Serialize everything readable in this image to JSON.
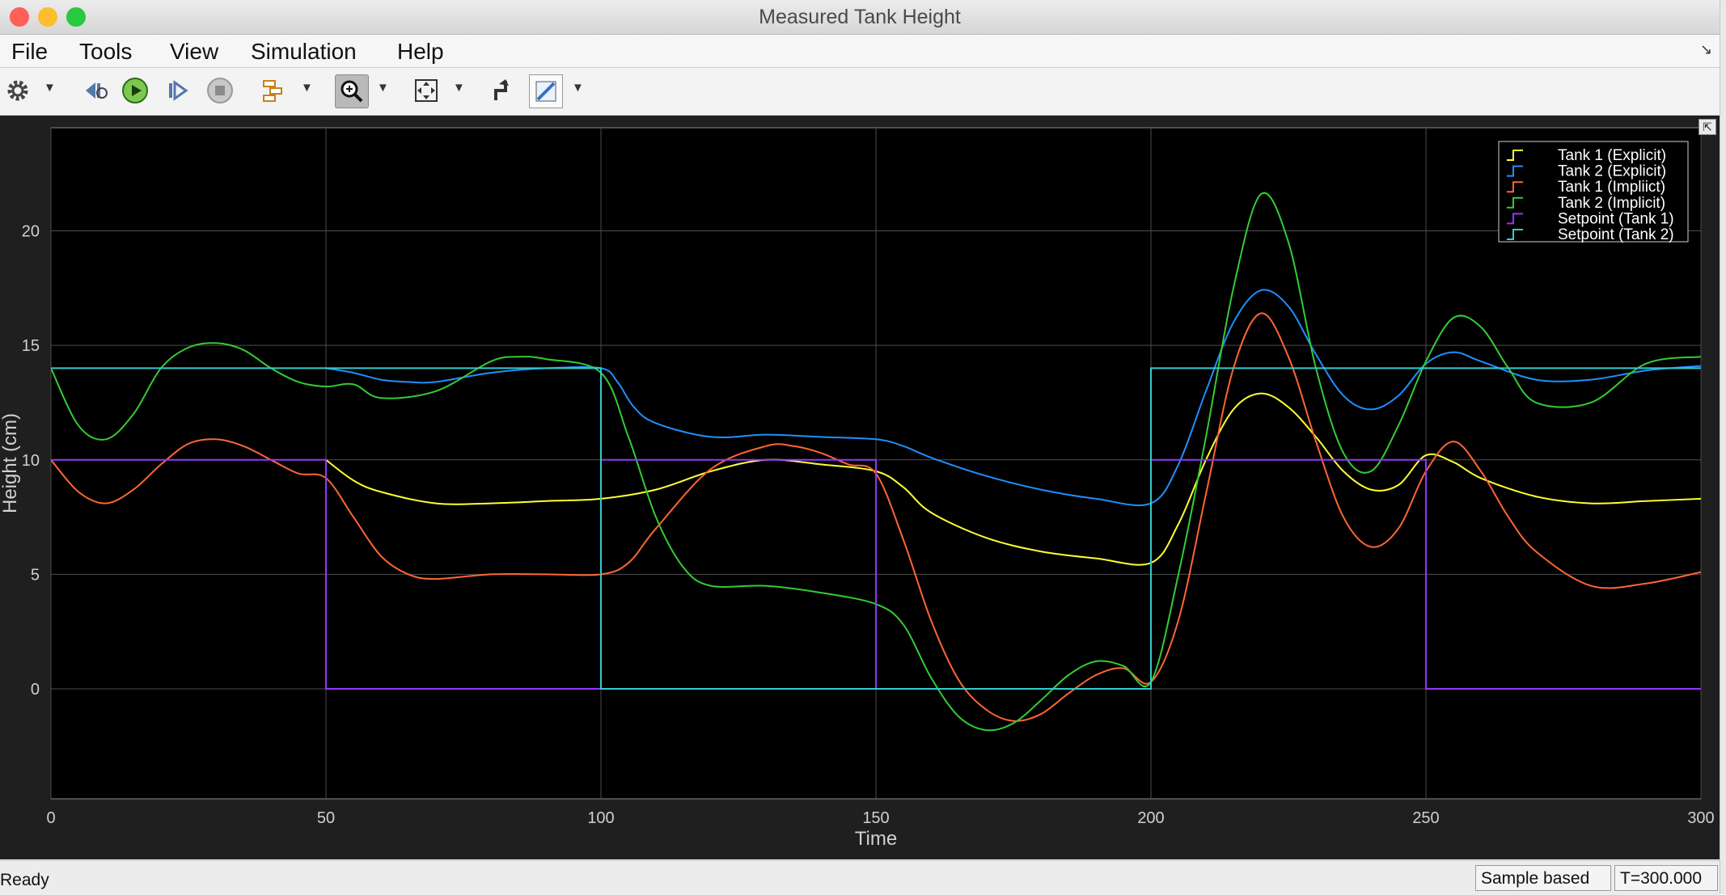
{
  "window": {
    "title": "Measured Tank Height"
  },
  "menu": {
    "file": "File",
    "tools": "Tools",
    "view": "View",
    "simulation": "Simulation",
    "help": "Help"
  },
  "status": {
    "text": "Ready",
    "mode": "Sample based",
    "time": "T=300.000"
  },
  "icons": [
    "gear-icon",
    "step-back-icon",
    "run-icon",
    "step-forward-icon",
    "stop-icon",
    "signal-selector-icon",
    "zoom-in-icon",
    "fit-to-view-icon",
    "triggers-icon",
    "measurements-icon"
  ],
  "chart_data": {
    "type": "line",
    "xlabel": "Time",
    "ylabel": "Height (cm)",
    "xlim": [
      0,
      300
    ],
    "ylim": [
      -4.8,
      24.5
    ],
    "xticks": [
      0,
      50,
      100,
      150,
      200,
      250,
      300
    ],
    "yticks": [
      0,
      5,
      10,
      15,
      20
    ],
    "grid": true,
    "legend_position": "top-right",
    "background": "#000000",
    "series": [
      {
        "name": "Tank 1 (Explicit)",
        "color": "#ffff33",
        "x": [
          50,
          55,
          60,
          70,
          80,
          90,
          100,
          110,
          120,
          130,
          140,
          150,
          155,
          160,
          170,
          180,
          190,
          200,
          205,
          210,
          215,
          220,
          225,
          230,
          235,
          240,
          245,
          250,
          255,
          260,
          270,
          280,
          290,
          300
        ],
        "y": [
          10,
          9.1,
          8.6,
          8.1,
          8.1,
          8.2,
          8.3,
          8.7,
          9.5,
          10,
          9.8,
          9.5,
          8.8,
          7.7,
          6.6,
          6,
          5.7,
          5.5,
          7.2,
          10,
          12.2,
          12.9,
          12.3,
          11,
          9.5,
          8.7,
          8.9,
          10.2,
          9.9,
          9.2,
          8.4,
          8.1,
          8.2,
          8.3
        ]
      },
      {
        "name": "Tank 2 (Explicit)",
        "color": "#1f8fff",
        "x": [
          50,
          55,
          60,
          65,
          70,
          80,
          90,
          100,
          103,
          106,
          110,
          120,
          130,
          140,
          150,
          155,
          160,
          170,
          180,
          190,
          200,
          205,
          210,
          215,
          220,
          225,
          230,
          235,
          240,
          245,
          250,
          255,
          260,
          270,
          280,
          290,
          300
        ],
        "y": [
          14,
          13.8,
          13.5,
          13.4,
          13.4,
          13.8,
          14,
          14,
          13.4,
          12.3,
          11.6,
          11,
          11.1,
          11,
          10.9,
          10.6,
          10.1,
          9.3,
          8.7,
          8.3,
          8.1,
          9.8,
          13,
          16,
          17.4,
          16.7,
          14.6,
          12.8,
          12.2,
          12.8,
          14.2,
          14.7,
          14.3,
          13.5,
          13.5,
          13.9,
          14.1
        ]
      },
      {
        "name": "Tank 1 (Impliict)",
        "color": "#ff6633",
        "x": [
          0,
          5,
          10,
          15,
          20,
          25,
          30,
          35,
          40,
          45,
          50,
          55,
          60,
          65,
          70,
          80,
          90,
          100,
          105,
          110,
          120,
          130,
          135,
          140,
          145,
          150,
          155,
          160,
          165,
          170,
          175,
          180,
          185,
          190,
          195,
          200,
          205,
          210,
          215,
          220,
          225,
          230,
          235,
          240,
          245,
          250,
          255,
          260,
          265,
          270,
          280,
          290,
          300
        ],
        "y": [
          10,
          8.6,
          8.1,
          8.7,
          9.8,
          10.7,
          10.9,
          10.6,
          10,
          9.4,
          9.2,
          7.5,
          5.8,
          5,
          4.8,
          5,
          5,
          5,
          5.5,
          7,
          9.6,
          10.6,
          10.6,
          10.3,
          9.8,
          9.4,
          6.5,
          3,
          0.4,
          -0.9,
          -1.4,
          -1.1,
          -0.2,
          0.6,
          0.9,
          0.3,
          3,
          8.5,
          14,
          16.4,
          14.5,
          10.8,
          7.5,
          6.2,
          7,
          9.5,
          10.8,
          9.5,
          7.5,
          6,
          4.5,
          4.6,
          5.1
        ]
      },
      {
        "name": "Tank 2 (Implicit)",
        "color": "#33cc33",
        "x": [
          0,
          5,
          10,
          15,
          20,
          25,
          30,
          35,
          40,
          45,
          50,
          55,
          60,
          70,
          80,
          85,
          90,
          100,
          105,
          110,
          115,
          120,
          130,
          140,
          150,
          155,
          160,
          165,
          170,
          175,
          180,
          185,
          190,
          195,
          200,
          205,
          210,
          215,
          220,
          225,
          230,
          235,
          240,
          245,
          250,
          255,
          260,
          265,
          270,
          280,
          290,
          300
        ],
        "y": [
          14,
          11.5,
          10.9,
          12,
          14,
          14.9,
          15.1,
          14.8,
          14,
          13.4,
          13.2,
          13.3,
          12.7,
          13,
          14.3,
          14.5,
          14.4,
          13.8,
          11,
          7.5,
          5.3,
          4.5,
          4.5,
          4.2,
          3.7,
          2.8,
          0.5,
          -1.2,
          -1.8,
          -1.5,
          -0.5,
          0.6,
          1.2,
          1,
          0.3,
          5,
          11,
          17.5,
          21.6,
          19.5,
          14,
          10.3,
          9.5,
          11.5,
          14.3,
          16.2,
          15.8,
          14,
          12.5,
          12.5,
          14.2,
          14.5
        ]
      },
      {
        "name": "Setpoint (Tank 1)",
        "color": "#9933ff",
        "x": [
          0,
          50,
          50,
          100,
          100,
          150,
          150,
          200,
          200,
          250,
          250,
          300
        ],
        "y": [
          10,
          10,
          0,
          0,
          10,
          10,
          0,
          0,
          10,
          10,
          0,
          0
        ]
      },
      {
        "name": "Setpoint (Tank 2)",
        "color": "#33cccc",
        "x": [
          0,
          100,
          100,
          200,
          200,
          300
        ],
        "y": [
          14,
          14,
          0,
          0,
          14,
          14
        ]
      }
    ]
  }
}
